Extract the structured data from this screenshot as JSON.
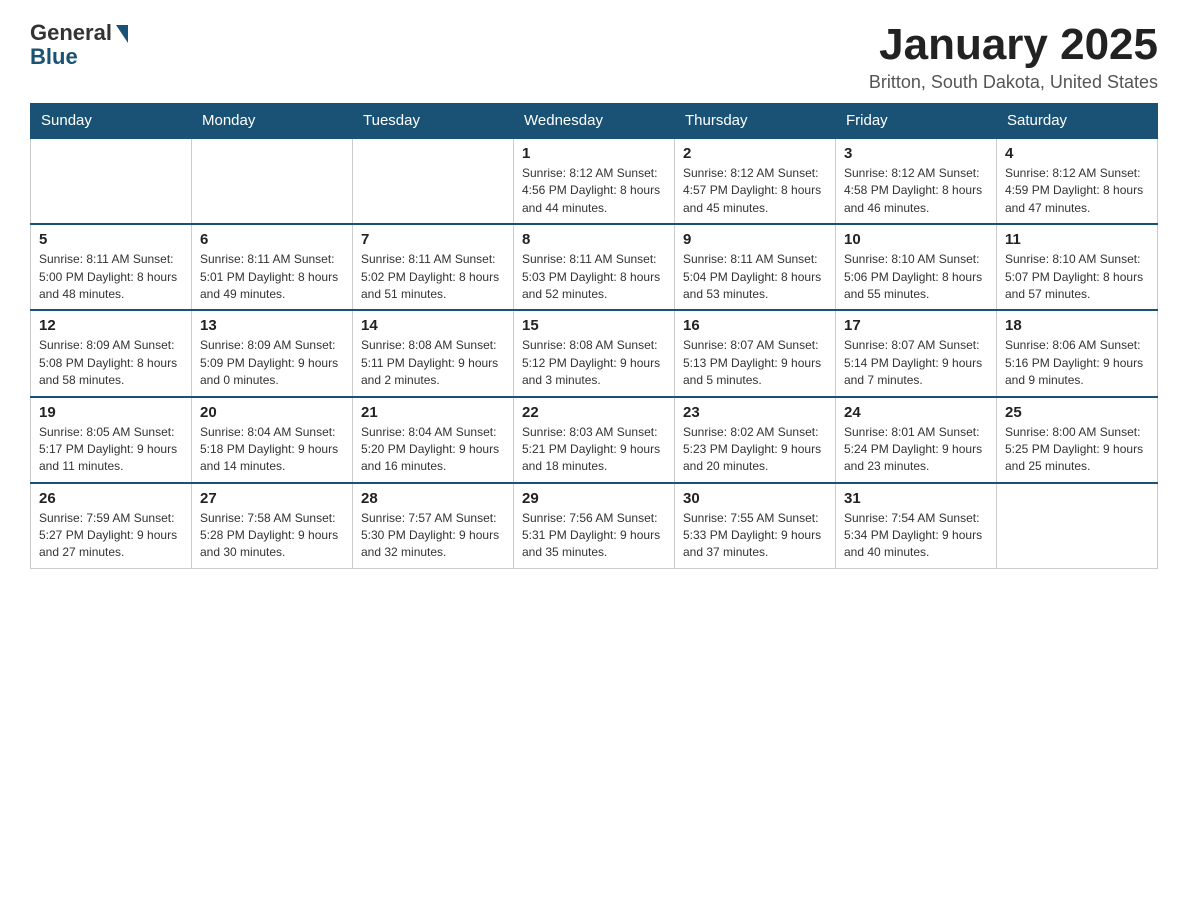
{
  "header": {
    "logo_general": "General",
    "logo_blue": "Blue",
    "month_title": "January 2025",
    "location": "Britton, South Dakota, United States"
  },
  "days_of_week": [
    "Sunday",
    "Monday",
    "Tuesday",
    "Wednesday",
    "Thursday",
    "Friday",
    "Saturday"
  ],
  "weeks": [
    [
      {
        "day": "",
        "info": ""
      },
      {
        "day": "",
        "info": ""
      },
      {
        "day": "",
        "info": ""
      },
      {
        "day": "1",
        "info": "Sunrise: 8:12 AM\nSunset: 4:56 PM\nDaylight: 8 hours\nand 44 minutes."
      },
      {
        "day": "2",
        "info": "Sunrise: 8:12 AM\nSunset: 4:57 PM\nDaylight: 8 hours\nand 45 minutes."
      },
      {
        "day": "3",
        "info": "Sunrise: 8:12 AM\nSunset: 4:58 PM\nDaylight: 8 hours\nand 46 minutes."
      },
      {
        "day": "4",
        "info": "Sunrise: 8:12 AM\nSunset: 4:59 PM\nDaylight: 8 hours\nand 47 minutes."
      }
    ],
    [
      {
        "day": "5",
        "info": "Sunrise: 8:11 AM\nSunset: 5:00 PM\nDaylight: 8 hours\nand 48 minutes."
      },
      {
        "day": "6",
        "info": "Sunrise: 8:11 AM\nSunset: 5:01 PM\nDaylight: 8 hours\nand 49 minutes."
      },
      {
        "day": "7",
        "info": "Sunrise: 8:11 AM\nSunset: 5:02 PM\nDaylight: 8 hours\nand 51 minutes."
      },
      {
        "day": "8",
        "info": "Sunrise: 8:11 AM\nSunset: 5:03 PM\nDaylight: 8 hours\nand 52 minutes."
      },
      {
        "day": "9",
        "info": "Sunrise: 8:11 AM\nSunset: 5:04 PM\nDaylight: 8 hours\nand 53 minutes."
      },
      {
        "day": "10",
        "info": "Sunrise: 8:10 AM\nSunset: 5:06 PM\nDaylight: 8 hours\nand 55 minutes."
      },
      {
        "day": "11",
        "info": "Sunrise: 8:10 AM\nSunset: 5:07 PM\nDaylight: 8 hours\nand 57 minutes."
      }
    ],
    [
      {
        "day": "12",
        "info": "Sunrise: 8:09 AM\nSunset: 5:08 PM\nDaylight: 8 hours\nand 58 minutes."
      },
      {
        "day": "13",
        "info": "Sunrise: 8:09 AM\nSunset: 5:09 PM\nDaylight: 9 hours\nand 0 minutes."
      },
      {
        "day": "14",
        "info": "Sunrise: 8:08 AM\nSunset: 5:11 PM\nDaylight: 9 hours\nand 2 minutes."
      },
      {
        "day": "15",
        "info": "Sunrise: 8:08 AM\nSunset: 5:12 PM\nDaylight: 9 hours\nand 3 minutes."
      },
      {
        "day": "16",
        "info": "Sunrise: 8:07 AM\nSunset: 5:13 PM\nDaylight: 9 hours\nand 5 minutes."
      },
      {
        "day": "17",
        "info": "Sunrise: 8:07 AM\nSunset: 5:14 PM\nDaylight: 9 hours\nand 7 minutes."
      },
      {
        "day": "18",
        "info": "Sunrise: 8:06 AM\nSunset: 5:16 PM\nDaylight: 9 hours\nand 9 minutes."
      }
    ],
    [
      {
        "day": "19",
        "info": "Sunrise: 8:05 AM\nSunset: 5:17 PM\nDaylight: 9 hours\nand 11 minutes."
      },
      {
        "day": "20",
        "info": "Sunrise: 8:04 AM\nSunset: 5:18 PM\nDaylight: 9 hours\nand 14 minutes."
      },
      {
        "day": "21",
        "info": "Sunrise: 8:04 AM\nSunset: 5:20 PM\nDaylight: 9 hours\nand 16 minutes."
      },
      {
        "day": "22",
        "info": "Sunrise: 8:03 AM\nSunset: 5:21 PM\nDaylight: 9 hours\nand 18 minutes."
      },
      {
        "day": "23",
        "info": "Sunrise: 8:02 AM\nSunset: 5:23 PM\nDaylight: 9 hours\nand 20 minutes."
      },
      {
        "day": "24",
        "info": "Sunrise: 8:01 AM\nSunset: 5:24 PM\nDaylight: 9 hours\nand 23 minutes."
      },
      {
        "day": "25",
        "info": "Sunrise: 8:00 AM\nSunset: 5:25 PM\nDaylight: 9 hours\nand 25 minutes."
      }
    ],
    [
      {
        "day": "26",
        "info": "Sunrise: 7:59 AM\nSunset: 5:27 PM\nDaylight: 9 hours\nand 27 minutes."
      },
      {
        "day": "27",
        "info": "Sunrise: 7:58 AM\nSunset: 5:28 PM\nDaylight: 9 hours\nand 30 minutes."
      },
      {
        "day": "28",
        "info": "Sunrise: 7:57 AM\nSunset: 5:30 PM\nDaylight: 9 hours\nand 32 minutes."
      },
      {
        "day": "29",
        "info": "Sunrise: 7:56 AM\nSunset: 5:31 PM\nDaylight: 9 hours\nand 35 minutes."
      },
      {
        "day": "30",
        "info": "Sunrise: 7:55 AM\nSunset: 5:33 PM\nDaylight: 9 hours\nand 37 minutes."
      },
      {
        "day": "31",
        "info": "Sunrise: 7:54 AM\nSunset: 5:34 PM\nDaylight: 9 hours\nand 40 minutes."
      },
      {
        "day": "",
        "info": ""
      }
    ]
  ]
}
